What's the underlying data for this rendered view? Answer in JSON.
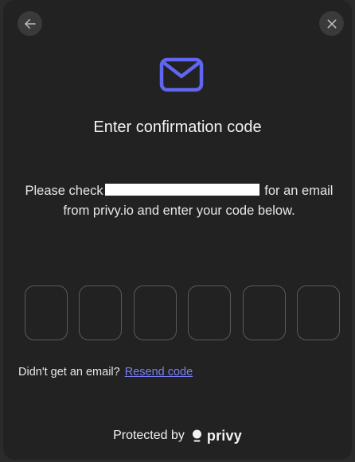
{
  "header": {
    "back_icon": "arrow-left-icon",
    "close_icon": "close-icon"
  },
  "hero": {
    "icon": "envelope-icon",
    "accent_color": "#6166f0"
  },
  "title": "Enter confirmation code",
  "description": {
    "before_email": "Please check",
    "after_email": "for an email from privy.io and enter your code below."
  },
  "code_inputs": {
    "count": 6,
    "values": [
      "",
      "",
      "",
      "",
      "",
      ""
    ]
  },
  "resend": {
    "prompt": "Didn't get an email?",
    "link_label": "Resend code",
    "link_color": "#7b7ef5"
  },
  "footer": {
    "protected_by": "Protected by",
    "brand": "privy",
    "logo_icon": "privy-logo-icon"
  }
}
